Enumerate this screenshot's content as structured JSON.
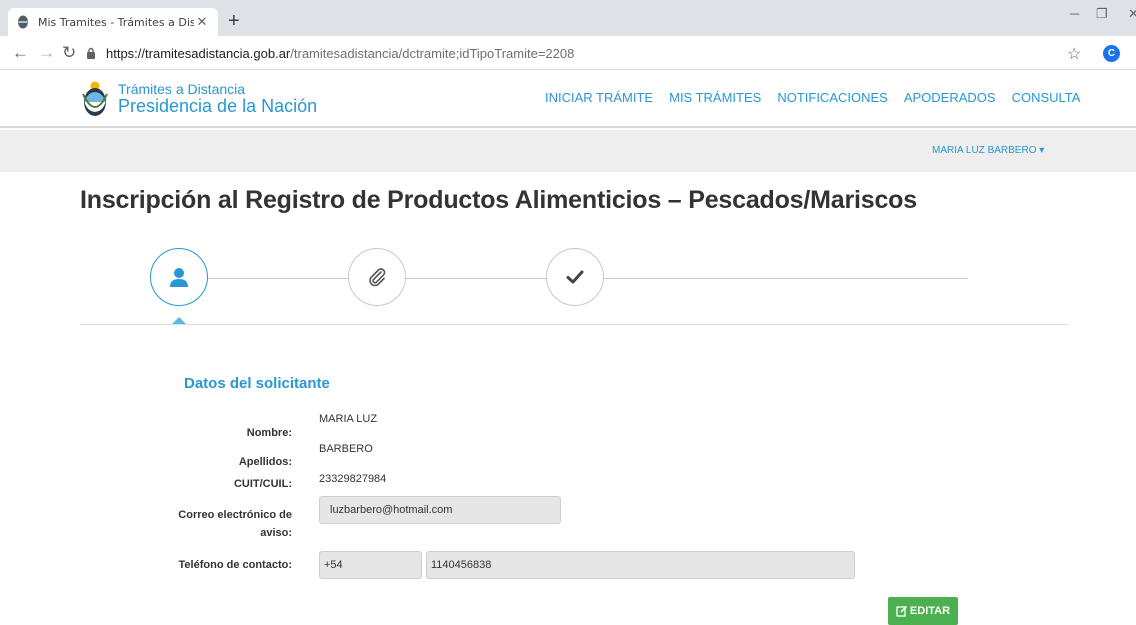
{
  "browser": {
    "tab_title": "Mis Tramites - Trámites a Distanc",
    "url_host": "https://tramitesadistancia.gob.ar",
    "url_path": "/tramitesadistancia/dctramite;idTipoTramite=2208",
    "profile_initial": "C"
  },
  "header": {
    "brand_line1": "Trámites a Distancia",
    "brand_line2": "Presidencia de la Nación",
    "nav": [
      "INICIAR TRÁMITE",
      "MIS TRÁMITES",
      "NOTIFICACIONES",
      "APODERADOS",
      "CONSULTA"
    ],
    "user_name": "MARIA LUZ BARBERO"
  },
  "page": {
    "title": "Inscripción al Registro de Productos Alimenticios – Pescados/Mariscos",
    "steps": [
      "user-icon",
      "paperclip-icon",
      "check-icon"
    ],
    "active_step": 1
  },
  "form": {
    "section_title": "Datos del solicitante",
    "nombre_label": "Nombre:",
    "nombre_value": "MARIA LUZ",
    "apellidos_label": "Apellidos:",
    "apellidos_value": "BARBERO",
    "cuit_label": "CUIT/CUIL:",
    "cuit_value": "23329827984",
    "correo_label_1": "Correo electrónico de",
    "correo_label_2": "aviso:",
    "correo_value": "luzbarbero@hotmail.com",
    "telefono_label": "Teléfono de contacto:",
    "telefono_prefix": "+54",
    "telefono_number": "1140456838",
    "edit_label": "EDITAR"
  },
  "colors": {
    "brand_blue": "#2897d4",
    "edit_green": "#4caf50"
  }
}
